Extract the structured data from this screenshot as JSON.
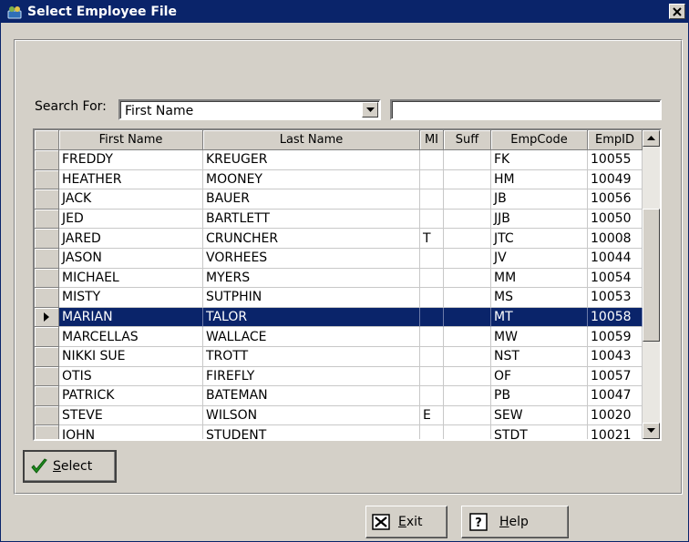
{
  "window": {
    "title": "Select Employee File"
  },
  "search": {
    "label": "Search For:",
    "field_selected": "First Name",
    "text_value": ""
  },
  "grid": {
    "columns": [
      "First Name",
      "Last Name",
      "MI",
      "Suff",
      "EmpCode",
      "EmpID"
    ],
    "selected_index": 8,
    "rows": [
      {
        "first": "FREDDY",
        "last": "KREUGER",
        "mi": "",
        "suff": "",
        "code": "FK",
        "id": "10055"
      },
      {
        "first": "HEATHER",
        "last": "MOONEY",
        "mi": "",
        "suff": "",
        "code": "HM",
        "id": "10049"
      },
      {
        "first": "JACK",
        "last": "BAUER",
        "mi": "",
        "suff": "",
        "code": "JB",
        "id": "10056"
      },
      {
        "first": "JED",
        "last": "BARTLETT",
        "mi": "",
        "suff": "",
        "code": "JJB",
        "id": "10050"
      },
      {
        "first": "JARED",
        "last": "CRUNCHER",
        "mi": "T",
        "suff": "",
        "code": "JTC",
        "id": "10008"
      },
      {
        "first": "JASON",
        "last": "VORHEES",
        "mi": "",
        "suff": "",
        "code": "JV",
        "id": "10044"
      },
      {
        "first": "MICHAEL",
        "last": "MYERS",
        "mi": "",
        "suff": "",
        "code": "MM",
        "id": "10054"
      },
      {
        "first": "MISTY",
        "last": "SUTPHIN",
        "mi": "",
        "suff": "",
        "code": "MS",
        "id": "10053"
      },
      {
        "first": "MARIAN",
        "last": "TALOR",
        "mi": "",
        "suff": "",
        "code": "MT",
        "id": "10058"
      },
      {
        "first": "MARCELLAS",
        "last": "WALLACE",
        "mi": "",
        "suff": "",
        "code": "MW",
        "id": "10059"
      },
      {
        "first": "NIKKI SUE",
        "last": "TROTT",
        "mi": "",
        "suff": "",
        "code": "NST",
        "id": "10043"
      },
      {
        "first": "OTIS",
        "last": "FIREFLY",
        "mi": "",
        "suff": "",
        "code": "OF",
        "id": "10057"
      },
      {
        "first": "PATRICK",
        "last": "BATEMAN",
        "mi": "",
        "suff": "",
        "code": "PB",
        "id": "10047"
      },
      {
        "first": "STEVE",
        "last": "WILSON",
        "mi": "E",
        "suff": "",
        "code": "SEW",
        "id": "10020"
      },
      {
        "first": "JOHN",
        "last": "STUDENT",
        "mi": "",
        "suff": "",
        "code": "STDT",
        "id": "10021"
      }
    ]
  },
  "buttons": {
    "select": {
      "mnemonic": "S",
      "rest": "elect"
    },
    "exit": {
      "mnemonic": "E",
      "rest": "xit"
    },
    "help": {
      "mnemonic": "H",
      "rest": "elp"
    }
  },
  "icons": {
    "app": "app-icon",
    "close": "close-icon",
    "dropdown": "chevron-down-icon",
    "select": "checkmark-icon",
    "exit": "exit-icon",
    "help": "help-icon",
    "row_pointer": "row-pointer-icon",
    "scroll_up": "scroll-up-icon",
    "scroll_down": "scroll-down-icon"
  },
  "colors": {
    "titlebar": "#0a246a",
    "selection": "#0a246a",
    "face": "#d4d0c8",
    "check": "#1f8f1f"
  }
}
